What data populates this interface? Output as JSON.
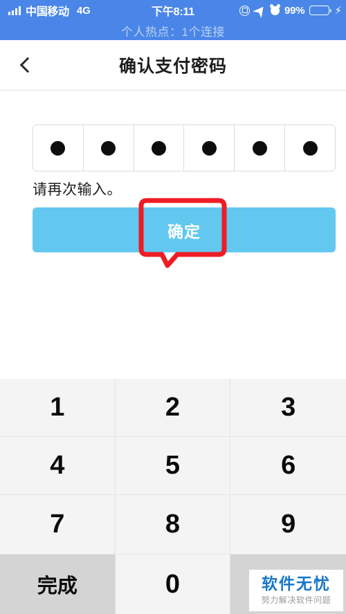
{
  "status_bar": {
    "signal_icon": "signal-bars-icon",
    "carrier": "中国移动",
    "network_type": "4G",
    "time": "下午8:11",
    "rotation_lock_icon": "rotation-lock-icon",
    "location_icon": "location-arrow-icon",
    "alarm_icon": "alarm-clock-icon",
    "battery_percent": "99%",
    "battery_icon": "battery-full-icon",
    "charging_icon": "⚡",
    "background_color": "#4a86e8"
  },
  "hotspot_banner": {
    "text": "个人热点：1个连接"
  },
  "navbar": {
    "back_icon": "back-chevron-icon",
    "title": "确认支付密码"
  },
  "pin_field": {
    "length": 6,
    "filled": 6,
    "dots": [
      "●",
      "●",
      "●",
      "●",
      "●",
      "●"
    ]
  },
  "hint": {
    "text": "请再次输入。"
  },
  "confirm_button": {
    "label": "确定",
    "color": "#63c8f0"
  },
  "annotation": {
    "shape": "callout-box",
    "color": "#ee1c25",
    "target": "confirm-button"
  },
  "keypad": {
    "keys": [
      {
        "label": "1",
        "type": "digit"
      },
      {
        "label": "2",
        "type": "digit"
      },
      {
        "label": "3",
        "type": "digit"
      },
      {
        "label": "4",
        "type": "digit"
      },
      {
        "label": "5",
        "type": "digit"
      },
      {
        "label": "6",
        "type": "digit"
      },
      {
        "label": "7",
        "type": "digit"
      },
      {
        "label": "8",
        "type": "digit"
      },
      {
        "label": "9",
        "type": "digit"
      },
      {
        "label": "完成",
        "type": "done"
      },
      {
        "label": "0",
        "type": "digit"
      },
      {
        "label": "",
        "type": "blank"
      }
    ]
  },
  "watermark": {
    "title": "软件无忧",
    "subtitle": "努力解决软件问题",
    "title_color": "#1877c9"
  }
}
